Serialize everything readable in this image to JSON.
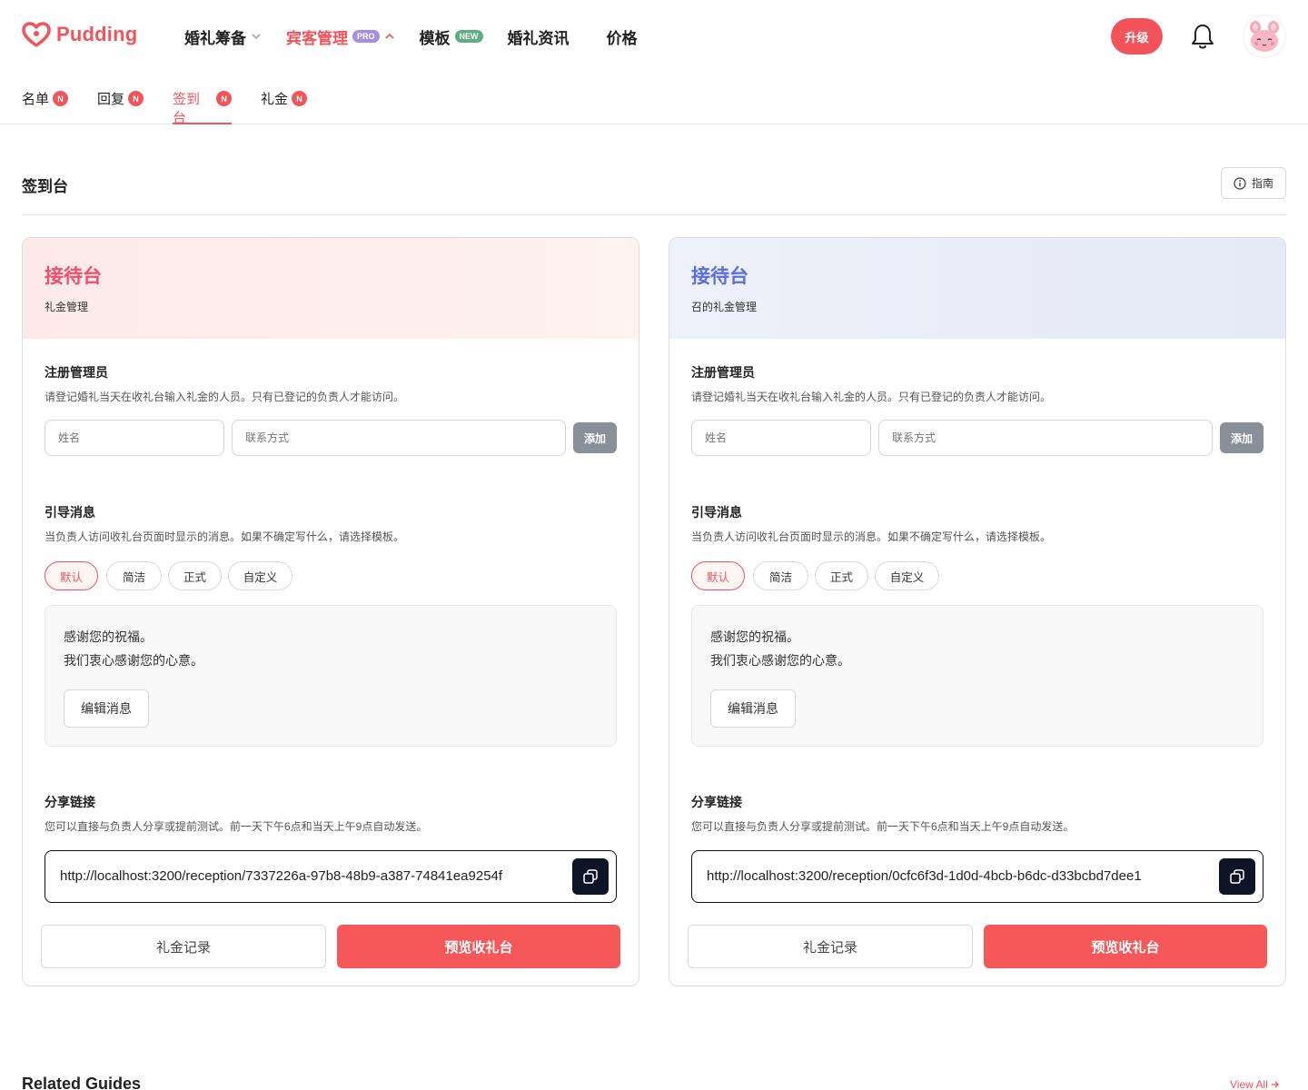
{
  "header": {
    "brand": "Pudding",
    "nav": [
      {
        "label": "婚礼筹备",
        "badge": "",
        "arrow": "down",
        "active": false
      },
      {
        "label": "宾客管理",
        "badge": "PRO",
        "arrow": "up",
        "active": true
      },
      {
        "label": "模板",
        "badge": "NEW",
        "arrow": "",
        "active": false
      },
      {
        "label": "婚礼资讯",
        "badge": "",
        "arrow": "",
        "active": false
      },
      {
        "label": "价格",
        "badge": "",
        "arrow": "",
        "active": false
      }
    ],
    "upgrade_label": "升级"
  },
  "subtabs": [
    {
      "label": "名单",
      "badge": "N"
    },
    {
      "label": "回复",
      "badge": "N"
    },
    {
      "label": "签到台",
      "badge": "N",
      "active": true
    },
    {
      "label": "礼金",
      "badge": "N"
    }
  ],
  "page": {
    "title": "签到台",
    "guide_label": "指南"
  },
  "cards": [
    {
      "title": "接待台",
      "subtitle": "礼金管理",
      "register": {
        "title": "注册管理员",
        "desc": "请登记婚礼当天在收礼台输入礼金的人员。只有已登记的负责人才能访问。",
        "name_placeholder": "姓名",
        "contact_placeholder": "联系方式",
        "add_label": "添加"
      },
      "guide_msg": {
        "title": "引导消息",
        "desc": "当负责人访问收礼台页面时显示的消息。如果不确定写什么，请选择模板。",
        "chips": [
          "默认",
          "简洁",
          "正式",
          "自定义"
        ],
        "selected": "默认",
        "line1": "感谢您的祝福。",
        "line2": "我们衷心感谢您的心意。",
        "edit_label": "编辑消息"
      },
      "share": {
        "title": "分享链接",
        "desc": "您可以直接与负责人分享或提前测试。前一天下午6点和当天上午9点自动发送。",
        "url": "http://localhost:3200/reception/7337226a-97b8-48b9-a387-74841ea9254f"
      },
      "records_label": "礼金记录",
      "preview_label": "预览收礼台"
    },
    {
      "title": "接待台",
      "subtitle": "召的礼金管理",
      "register": {
        "title": "注册管理员",
        "desc": "请登记婚礼当天在收礼台输入礼金的人员。只有已登记的负责人才能访问。",
        "name_placeholder": "姓名",
        "contact_placeholder": "联系方式",
        "add_label": "添加"
      },
      "guide_msg": {
        "title": "引导消息",
        "desc": "当负责人访问收礼台页面时显示的消息。如果不确定写什么，请选择模板。",
        "chips": [
          "默认",
          "简洁",
          "正式",
          "自定义"
        ],
        "selected": "默认",
        "line1": "感谢您的祝福。",
        "line2": "我们衷心感谢您的心意。",
        "edit_label": "编辑消息"
      },
      "share": {
        "title": "分享链接",
        "desc": "您可以直接与负责人分享或提前测试。前一天下午6点和当天上午9点自动发送。",
        "url": "http://localhost:3200/reception/0cfc6f3d-1d0d-4bcb-b6dc-d33bcbd7dee1"
      },
      "records_label": "礼金记录",
      "preview_label": "预览收礼台"
    }
  ],
  "related": {
    "title": "Related Guides",
    "view_all": "View All"
  },
  "colors": {
    "brand": "#f1545b",
    "pink_title": "#ef4f6c",
    "blue_title": "#5a6ee3",
    "copy_button": "#0c1426"
  }
}
